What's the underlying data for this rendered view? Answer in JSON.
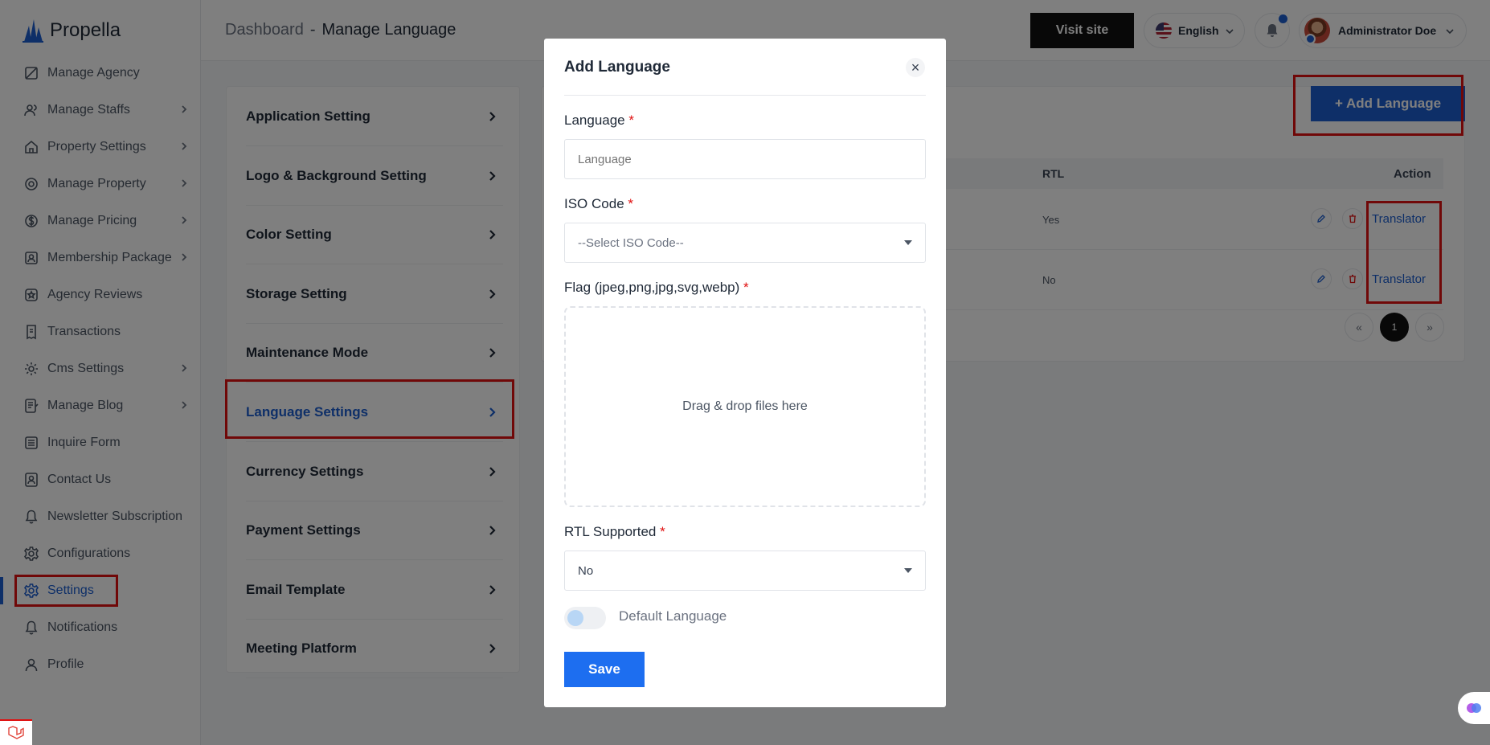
{
  "brand": {
    "name": "Propella"
  },
  "header": {
    "breadcrumb_root": "Dashboard",
    "breadcrumb_sep": "-",
    "breadcrumb_current": "Manage Language",
    "visit_site": "Visit site",
    "language": "English",
    "user_name": "Administrator Doe"
  },
  "sidebar": {
    "items": [
      {
        "label": "Manage Agency",
        "icon": "agency-icon",
        "chevron": false
      },
      {
        "label": "Manage Staffs",
        "icon": "users-icon",
        "chevron": true
      },
      {
        "label": "Property Settings",
        "icon": "home-icon",
        "chevron": true
      },
      {
        "label": "Manage Property",
        "icon": "badge-icon",
        "chevron": true
      },
      {
        "label": "Manage Pricing",
        "icon": "dollar-icon",
        "chevron": true
      },
      {
        "label": "Membership Package",
        "icon": "id-card-icon",
        "chevron": true
      },
      {
        "label": "Agency Reviews",
        "icon": "star-icon",
        "chevron": false
      },
      {
        "label": "Transactions",
        "icon": "receipt-icon",
        "chevron": false
      },
      {
        "label": "Cms Settings",
        "icon": "gear-icon",
        "chevron": true
      },
      {
        "label": "Manage Blog",
        "icon": "blog-icon",
        "chevron": true
      },
      {
        "label": "Inquire Form",
        "icon": "list-icon",
        "chevron": false
      },
      {
        "label": "Contact Us",
        "icon": "contact-icon",
        "chevron": false
      },
      {
        "label": "Newsletter Subscription",
        "icon": "bell-icon",
        "chevron": false
      },
      {
        "label": "Configurations",
        "icon": "cog-icon",
        "chevron": false
      },
      {
        "label": "Settings",
        "icon": "settings-icon",
        "chevron": false,
        "active": true
      },
      {
        "label": "Notifications",
        "icon": "bell-icon",
        "chevron": false
      },
      {
        "label": "Profile",
        "icon": "user-icon",
        "chevron": false
      }
    ]
  },
  "settings_menu": {
    "items": [
      "Application Setting",
      "Logo & Background Setting",
      "Color Setting",
      "Storage Setting",
      "Maintenance Mode",
      "Language Settings",
      "Currency Settings",
      "Payment Settings",
      "Email Template",
      "Meeting Platform"
    ],
    "active_index": 5
  },
  "language_table": {
    "add_button": "+ Add Language",
    "col_rtl": "RTL",
    "col_action": "Action",
    "rows": [
      {
        "rtl": "Yes",
        "action": "Translator"
      },
      {
        "rtl": "No",
        "action": "Translator"
      }
    ],
    "pagination": {
      "prev": "«",
      "current": "1",
      "next": "»"
    }
  },
  "modal": {
    "title": "Add Language",
    "close": "×",
    "language_label": "Language",
    "language_placeholder": "Language",
    "iso_label": "ISO Code",
    "iso_value": "--Select ISO Code--",
    "flag_label": "Flag (jpeg,png,jpg,svg,webp)",
    "drop_text": "Drag & drop files here",
    "rtl_label": "RTL Supported",
    "rtl_value": "No",
    "default_label": "Default Language",
    "save": "Save",
    "required_mark": "*"
  },
  "colors": {
    "accent": "#1d5fd1",
    "highlight": "#e01010",
    "dark": "#111111"
  }
}
